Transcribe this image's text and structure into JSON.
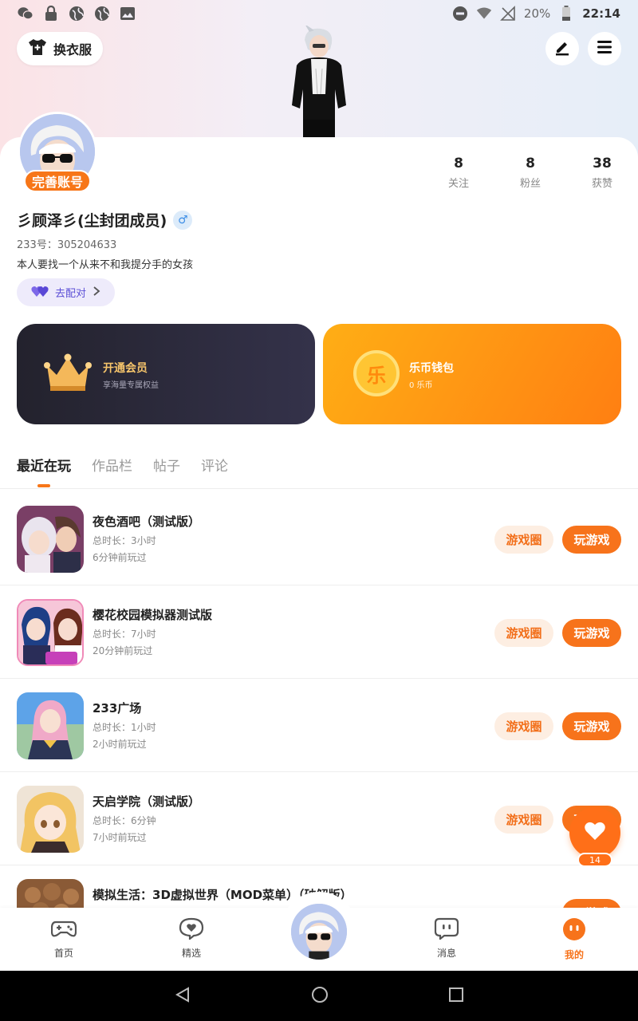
{
  "status_bar": {
    "battery": "20%",
    "time": "22:14"
  },
  "header": {
    "change_clothes": "换衣服"
  },
  "profile": {
    "complete_badge": "完善账号",
    "stats": [
      {
        "value": "8",
        "label": "关注"
      },
      {
        "value": "8",
        "label": "粉丝"
      },
      {
        "value": "38",
        "label": "获赞"
      }
    ],
    "username": "彡顾泽彡(尘封团成员)",
    "gender": "♂",
    "uid": "233号：305204633",
    "bio": "本人要找一个从来不和我提分手的女孩",
    "match_label": "去配对"
  },
  "vip": {
    "title": "开通会员",
    "subtitle": "享海量专属权益"
  },
  "wallet": {
    "title": "乐币钱包",
    "subtitle": "0 乐币",
    "coin_glyph": "乐"
  },
  "tabs": [
    "最近在玩",
    "作品栏",
    "帖子",
    "评论"
  ],
  "games": [
    {
      "name": "夜色酒吧（测试版）",
      "duration": "总时长：3小时",
      "last": "6分钟前玩过",
      "circle": "游戏圈",
      "play": "玩游戏"
    },
    {
      "name": "樱花校园模拟器测试版",
      "duration": "总时长：7小时",
      "last": "20分钟前玩过",
      "circle": "游戏圈",
      "play": "玩游戏"
    },
    {
      "name": "233广场",
      "duration": "总时长：1小时",
      "last": "2小时前玩过",
      "circle": "游戏圈",
      "play": "玩游戏"
    },
    {
      "name": "天启学院（测试版）",
      "duration": "总时长：6分钟",
      "last": "7小时前玩过",
      "circle": "游戏圈",
      "play": "玩游戏"
    },
    {
      "name": "模拟生活：3D虚拟世界（MOD菜单）（破解版）",
      "duration": "",
      "last": "",
      "circle": "",
      "play": "玩游戏"
    }
  ],
  "like_fab": {
    "count": "14"
  },
  "bottom_nav": {
    "items": [
      {
        "label": "首页",
        "icon": "gamepad-icon"
      },
      {
        "label": "精选",
        "icon": "heart-chat-icon"
      },
      {
        "label": "消息",
        "icon": "message-icon"
      },
      {
        "label": "我的",
        "icon": "profile-face-icon"
      }
    ],
    "active_color": "#f7731b"
  },
  "colors": {
    "accent": "#f7731b",
    "vip_bg": "#2a2937",
    "wallet_bg": "#ff8f14"
  }
}
